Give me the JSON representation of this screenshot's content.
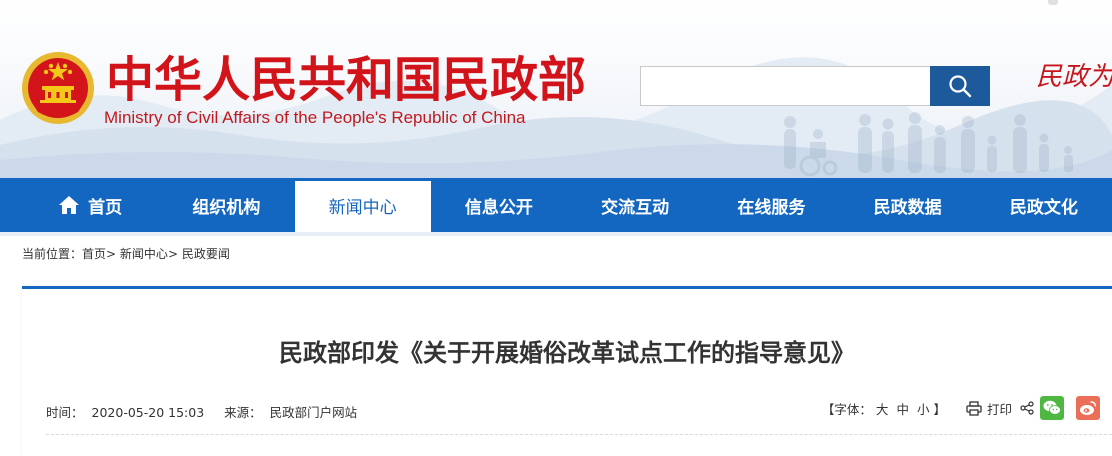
{
  "header": {
    "title_cn": "中华人民共和国民政部",
    "title_en": "Ministry of Civil Affairs of the People's Republic of China",
    "slogan": "民政为",
    "search": {
      "placeholder": "",
      "button_icon": "search-icon"
    }
  },
  "nav": {
    "items": [
      {
        "label": "首页",
        "icon": "home-icon"
      },
      {
        "label": "组织机构"
      },
      {
        "label": "新闻中心",
        "active": true
      },
      {
        "label": "信息公开"
      },
      {
        "label": "交流互动"
      },
      {
        "label": "在线服务"
      },
      {
        "label": "民政数据"
      },
      {
        "label": "民政文化"
      }
    ]
  },
  "breadcrumb": {
    "prefix": "当前位置：",
    "items": [
      "首页",
      "新闻中心",
      "民政要闻"
    ],
    "separator": ">"
  },
  "article": {
    "title": "民政部印发《关于开展婚俗改革试点工作的指导意见》",
    "time_label": "时间：",
    "time": "2020-05-20 15:03",
    "source_label": "来源：",
    "source": "民政部门户网站"
  },
  "tools": {
    "font_label": "【字体：",
    "font_large": "大",
    "font_medium": "中",
    "font_small": "小",
    "font_close": "】",
    "print_label": "打印"
  },
  "colors": {
    "nav_blue": "#1467c0",
    "brand_red": "#d2141a",
    "search_blue": "#1d5a9c",
    "wechat_green": "#4fb843",
    "weibo_orange": "#eb6f58"
  }
}
